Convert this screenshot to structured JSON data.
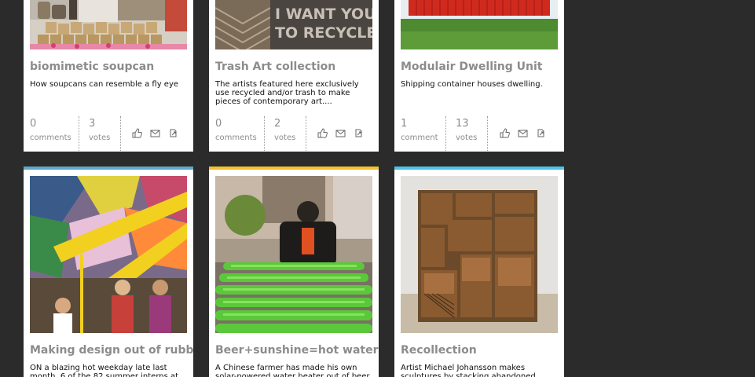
{
  "colors": {
    "bg": "#2c2b2b",
    "title": "#8c8c8c",
    "accent_blue": "#5fa8c8",
    "accent_yellow": "#f2c12e",
    "accent_cyan": "#4cc3e6"
  },
  "icons": {
    "like": "thumbs-up-icon",
    "email": "envelope-icon",
    "share": "share-icon"
  },
  "cards": [
    {
      "title": "biomimetic soupcan",
      "desc": "How soupcans can resemble a fly eye",
      "comments": "0",
      "comments_label": "comments",
      "votes": "3",
      "votes_label": "votes"
    },
    {
      "title": "Trash Art collection",
      "image_text_line1": "I WANT YOU",
      "image_text_line2": "TO RECYCLE",
      "desc": "The artists featured here exclusively use recycled and/or trash to make pieces of contemporary art....",
      "comments": "0",
      "comments_label": "comments",
      "votes": "2",
      "votes_label": "votes"
    },
    {
      "title": "Modulair Dwelling Unit",
      "desc": "Shipping container houses dwelling.",
      "comments": "1",
      "comments_label": "comment",
      "votes": "13",
      "votes_label": "votes"
    },
    {
      "title": "Making design out of rubbish",
      "desc": "ON a blazing hot weekday late last month, 6 of the 82 summer interns at"
    },
    {
      "title": "Beer+sunshine=hot water",
      "desc": "A Chinese farmer has made his own solar-powered water heater out of beer"
    },
    {
      "title": "Recollection",
      "desc": "Artist Michael Johansson makes sculptures by stacking abandoned"
    }
  ]
}
